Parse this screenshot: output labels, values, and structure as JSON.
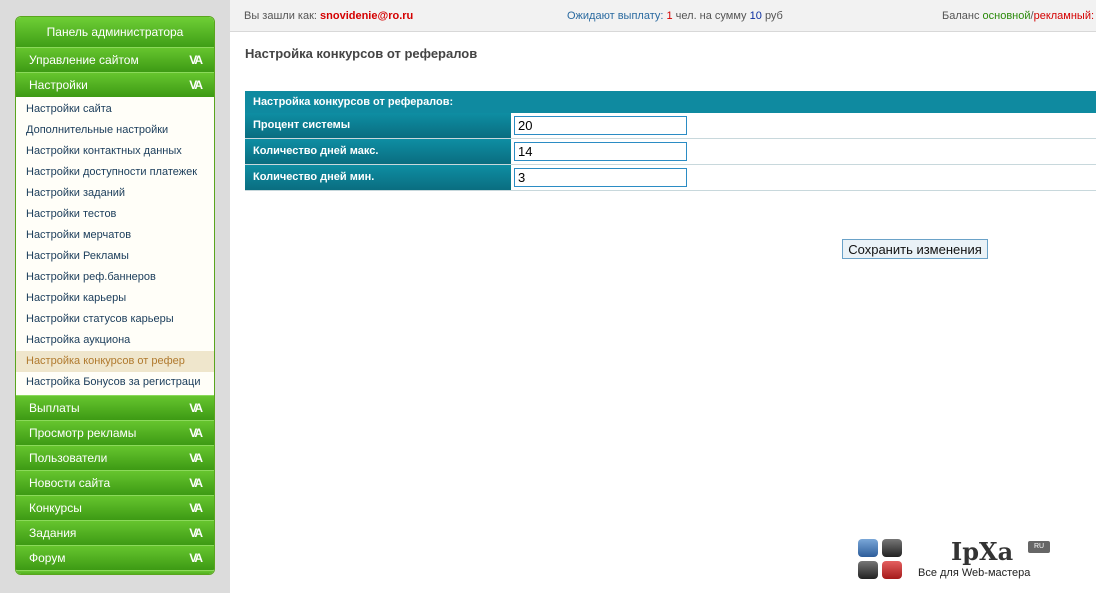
{
  "sidebar": {
    "title": "Панель администратора",
    "sections_top": [
      {
        "label": "Управление сайтом"
      },
      {
        "label": "Настройки"
      }
    ],
    "settings_items": [
      {
        "label": "Настройки сайта"
      },
      {
        "label": "Дополнительные настройки"
      },
      {
        "label": "Настройки контактных данных"
      },
      {
        "label": "Настройки доступности платежек"
      },
      {
        "label": "Настройки заданий"
      },
      {
        "label": "Настройки тестов"
      },
      {
        "label": "Настройки мерчатов"
      },
      {
        "label": "Настройки Рекламы"
      },
      {
        "label": "Настройки реф.баннеров"
      },
      {
        "label": "Настройки карьеры"
      },
      {
        "label": "Настройки статусов карьеры"
      },
      {
        "label": "Настройка аукциона"
      },
      {
        "label": "Настройка конкурсов от рефер"
      },
      {
        "label": "Настройка Бонусов за регистраци"
      }
    ],
    "active_item_index": 12,
    "sections_bottom": [
      {
        "label": "Выплаты"
      },
      {
        "label": "Просмотр рекламы"
      },
      {
        "label": "Пользователи"
      },
      {
        "label": "Новости сайта"
      },
      {
        "label": "Конкурсы"
      },
      {
        "label": "Задания"
      },
      {
        "label": "Форум"
      }
    ],
    "chevron": "VA"
  },
  "topbar": {
    "login_prefix": "Вы зашли как:",
    "login_email": "snovidenie@ro.ru",
    "pay_prefix": "Ожидают выплату:",
    "pay_count": "1",
    "pay_mid": "чел. на сумму",
    "pay_sum": "10",
    "pay_currency": "руб",
    "balance_prefix": "Баланс",
    "balance_main": "основной",
    "balance_sep": "/",
    "balance_ads": "рекламный:",
    "balance_tail": "/"
  },
  "main": {
    "page_title": "Настройка конкурсов от рефералов",
    "table_header": "Настройка конкурсов от рефералов:",
    "rows": [
      {
        "label": "Процент системы",
        "value": "20"
      },
      {
        "label": "Количество дней макс.",
        "value": "14"
      },
      {
        "label": "Количество дней мин.",
        "value": "3"
      }
    ],
    "save_button": "Сохранить изменения"
  },
  "logo": {
    "name": "IpXa",
    "badge": "RU",
    "tagline": "Все для Web-мастера"
  },
  "colors": {
    "accent_green": "#4fb21f",
    "table_teal": "#0f8aa0",
    "active_item_bg": "#efe6cc",
    "active_item_text": "#b07a2e"
  }
}
